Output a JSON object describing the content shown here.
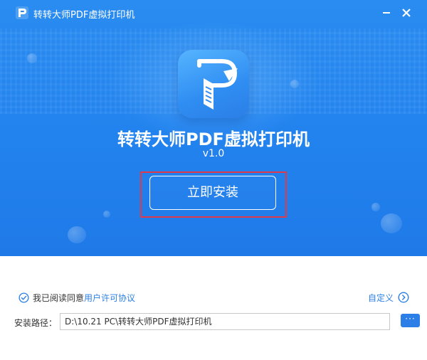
{
  "window": {
    "title": "转转大师PDF虚拟打印机",
    "app_icon": "app-logo-icon",
    "minimize_icon": "minimize-icon",
    "close_icon": "close-icon"
  },
  "hero": {
    "logo_icon": "pdf-printer-logo-icon",
    "product_name": "转转大师PDF虚拟打印机",
    "version": "v1.0",
    "install_button_label": "立即安装"
  },
  "agreement": {
    "checkbox_icon": "check-circle-icon",
    "checked": true,
    "text": "我已阅读同意",
    "license_link": "用户许可协议"
  },
  "custom": {
    "label": "自定义",
    "icon": "chevron-right-circle-icon"
  },
  "install_path": {
    "label": "安装路径：",
    "value": "D:\\10.21 PC\\转转大师PDF虚拟打印机",
    "browse_label": "···"
  },
  "colors": {
    "hero_blue": "#2384ef",
    "accent_blue": "#2b7fe6",
    "highlight_red": "#e03a4a"
  }
}
